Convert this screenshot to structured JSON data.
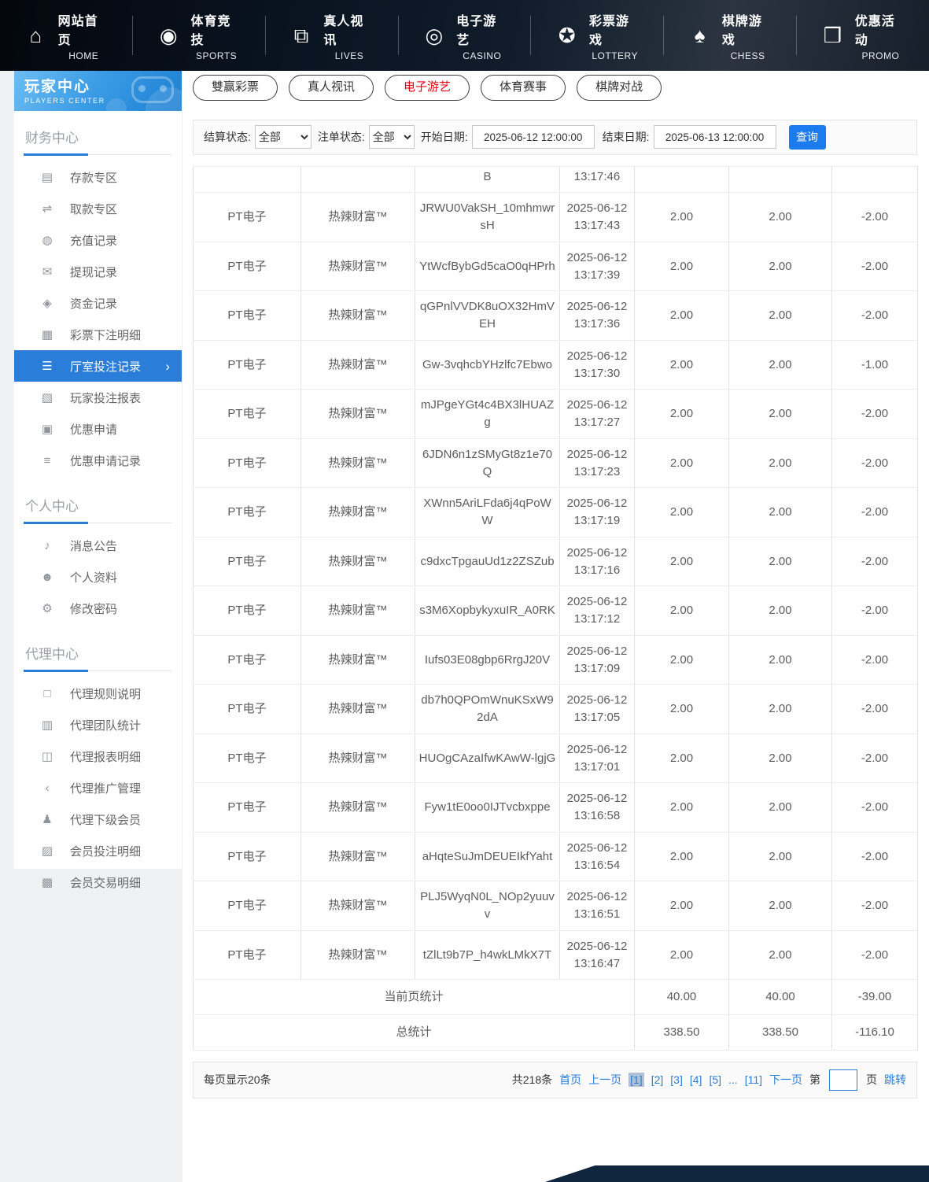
{
  "topnav": {
    "items": [
      {
        "zh": "网站首页",
        "en": "HOME",
        "icon": "home-icon"
      },
      {
        "zh": "体育竞技",
        "en": "SPORTS",
        "icon": "sports-icon"
      },
      {
        "zh": "真人视讯",
        "en": "LIVES",
        "icon": "lives-icon"
      },
      {
        "zh": "电子游艺",
        "en": "CASINO",
        "icon": "casino-icon"
      },
      {
        "zh": "彩票游戏",
        "en": "LOTTERY",
        "icon": "lottery-icon"
      },
      {
        "zh": "棋牌游戏",
        "en": "CHESS",
        "icon": "chess-icon"
      },
      {
        "zh": "优惠活动",
        "en": "PROMO",
        "icon": "promo-icon"
      }
    ]
  },
  "sidebar": {
    "title": "玩家中心",
    "subtitle": "PLAYERS CENTER",
    "sections": [
      {
        "title": "财务中心",
        "items": [
          {
            "label": "存款专区",
            "icon": "deposit-icon"
          },
          {
            "label": "取款专区",
            "icon": "withdraw-icon"
          },
          {
            "label": "充值记录",
            "icon": "recharge-record-icon"
          },
          {
            "label": "提现记录",
            "icon": "withdrawal-record-icon"
          },
          {
            "label": "资金记录",
            "icon": "funds-record-icon"
          },
          {
            "label": "彩票下注明细",
            "icon": "lottery-bet-detail-icon"
          },
          {
            "label": "厅室投注记录",
            "icon": "hall-bet-record-icon",
            "active": true
          },
          {
            "label": "玩家投注报表",
            "icon": "player-bet-report-icon"
          },
          {
            "label": "优惠申请",
            "icon": "promo-apply-icon"
          },
          {
            "label": "优惠申请记录",
            "icon": "promo-apply-record-icon"
          }
        ]
      },
      {
        "title": "个人中心",
        "items": [
          {
            "label": "消息公告",
            "icon": "announcement-icon"
          },
          {
            "label": "个人资料",
            "icon": "profile-icon"
          },
          {
            "label": "修改密码",
            "icon": "password-icon"
          }
        ]
      },
      {
        "title": "代理中心",
        "items": [
          {
            "label": "代理规则说明",
            "icon": "agent-rules-icon"
          },
          {
            "label": "代理团队统计",
            "icon": "agent-team-icon"
          },
          {
            "label": "代理报表明细",
            "icon": "agent-report-icon"
          },
          {
            "label": "代理推广管理",
            "icon": "agent-promo-icon"
          },
          {
            "label": "代理下级会员",
            "icon": "agent-members-icon"
          },
          {
            "label": "会员投注明细",
            "icon": "member-bet-detail-icon"
          },
          {
            "label": "会员交易明细",
            "icon": "member-trade-detail-icon"
          }
        ]
      }
    ]
  },
  "tabs": {
    "items": [
      {
        "label": "雙赢彩票"
      },
      {
        "label": "真人视讯"
      },
      {
        "label": "电子游艺",
        "active": true
      },
      {
        "label": "体育赛事"
      },
      {
        "label": "棋牌对战"
      }
    ]
  },
  "filters": {
    "settle_label": "结算状态:",
    "settle_value": "全部",
    "order_label": "注单状态:",
    "order_value": "全部",
    "start_label": "开始日期:",
    "start_value": "2025-06-12 12:00:00",
    "end_label": "结束日期:",
    "end_value": "2025-06-13 12:00:00",
    "search_label": "查询"
  },
  "table": {
    "partial_row": {
      "order_id": "B",
      "time": "13:17:46"
    },
    "rows": [
      {
        "platform": "PT电子",
        "game": "热辣财富™",
        "order_id": "JRWU0VakSH_10mhmwrsH",
        "date": "2025-06-12",
        "time": "13:17:43",
        "bet": "2.00",
        "valid": "2.00",
        "winloss": "-2.00"
      },
      {
        "platform": "PT电子",
        "game": "热辣财富™",
        "order_id": "YtWcfBybGd5caO0qHPrh",
        "date": "2025-06-12",
        "time": "13:17:39",
        "bet": "2.00",
        "valid": "2.00",
        "winloss": "-2.00"
      },
      {
        "platform": "PT电子",
        "game": "热辣财富™",
        "order_id": "qGPnlVVDK8uOX32HmVEH",
        "date": "2025-06-12",
        "time": "13:17:36",
        "bet": "2.00",
        "valid": "2.00",
        "winloss": "-2.00"
      },
      {
        "platform": "PT电子",
        "game": "热辣财富™",
        "order_id": "Gw-3vqhcbYHzlfc7Ebwo",
        "date": "2025-06-12",
        "time": "13:17:30",
        "bet": "2.00",
        "valid": "2.00",
        "winloss": "-1.00"
      },
      {
        "platform": "PT电子",
        "game": "热辣财富™",
        "order_id": "mJPgeYGt4c4BX3lHUAZg",
        "date": "2025-06-12",
        "time": "13:17:27",
        "bet": "2.00",
        "valid": "2.00",
        "winloss": "-2.00"
      },
      {
        "platform": "PT电子",
        "game": "热辣财富™",
        "order_id": "6JDN6n1zSMyGt8z1e70Q",
        "date": "2025-06-12",
        "time": "13:17:23",
        "bet": "2.00",
        "valid": "2.00",
        "winloss": "-2.00"
      },
      {
        "platform": "PT电子",
        "game": "热辣财富™",
        "order_id": "XWnn5AriLFda6j4qPoWW",
        "date": "2025-06-12",
        "time": "13:17:19",
        "bet": "2.00",
        "valid": "2.00",
        "winloss": "-2.00"
      },
      {
        "platform": "PT电子",
        "game": "热辣财富™",
        "order_id": "c9dxcTpgauUd1z2ZSZub",
        "date": "2025-06-12",
        "time": "13:17:16",
        "bet": "2.00",
        "valid": "2.00",
        "winloss": "-2.00"
      },
      {
        "platform": "PT电子",
        "game": "热辣财富™",
        "order_id": "s3M6XopbykyxuIR_A0RK",
        "date": "2025-06-12",
        "time": "13:17:12",
        "bet": "2.00",
        "valid": "2.00",
        "winloss": "-2.00"
      },
      {
        "platform": "PT电子",
        "game": "热辣财富™",
        "order_id": "Iufs03E08gbp6RrgJ20V",
        "date": "2025-06-12",
        "time": "13:17:09",
        "bet": "2.00",
        "valid": "2.00",
        "winloss": "-2.00"
      },
      {
        "platform": "PT电子",
        "game": "热辣财富™",
        "order_id": "db7h0QPOmWnuKSxW92dA",
        "date": "2025-06-12",
        "time": "13:17:05",
        "bet": "2.00",
        "valid": "2.00",
        "winloss": "-2.00"
      },
      {
        "platform": "PT电子",
        "game": "热辣财富™",
        "order_id": "HUOgCAzaIfwKAwW-lgjG",
        "date": "2025-06-12",
        "time": "13:17:01",
        "bet": "2.00",
        "valid": "2.00",
        "winloss": "-2.00"
      },
      {
        "platform": "PT电子",
        "game": "热辣财富™",
        "order_id": "Fyw1tE0oo0IJTvcbxppe",
        "date": "2025-06-12",
        "time": "13:16:58",
        "bet": "2.00",
        "valid": "2.00",
        "winloss": "-2.00"
      },
      {
        "platform": "PT电子",
        "game": "热辣财富™",
        "order_id": "aHqteSuJmDEUEIkfYaht",
        "date": "2025-06-12",
        "time": "13:16:54",
        "bet": "2.00",
        "valid": "2.00",
        "winloss": "-2.00"
      },
      {
        "platform": "PT电子",
        "game": "热辣财富™",
        "order_id": "PLJ5WyqN0L_NOp2yuuvv",
        "date": "2025-06-12",
        "time": "13:16:51",
        "bet": "2.00",
        "valid": "2.00",
        "winloss": "-2.00"
      },
      {
        "platform": "PT电子",
        "game": "热辣财富™",
        "order_id": "tZlLt9b7P_h4wkLMkX7T",
        "date": "2025-06-12",
        "time": "13:16:47",
        "bet": "2.00",
        "valid": "2.00",
        "winloss": "-2.00"
      }
    ],
    "page_stats": {
      "label": "当前页统计",
      "bet": "40.00",
      "valid": "40.00",
      "winloss": "-39.00"
    },
    "total_stats": {
      "label": "总统计",
      "bet": "338.50",
      "valid": "338.50",
      "winloss": "-116.10"
    }
  },
  "pagination": {
    "per_page": "每页显示20条",
    "total": "共218条",
    "first": "首页",
    "prev": "上一页",
    "pages": [
      "[1]",
      "[2]",
      "[3]",
      "[4]",
      "[5]"
    ],
    "ellipsis": "...",
    "last_page": "[11]",
    "next": "下一页",
    "jump_prefix": "第",
    "jump_value": "",
    "jump_suffix": "页",
    "jump_button": "跳转"
  },
  "colors": {
    "accent_blue": "#2a7dd8",
    "active_tab_red": "#e60012",
    "search_button_blue": "#1d7bf0",
    "topnav_dark": "#0a1420"
  }
}
